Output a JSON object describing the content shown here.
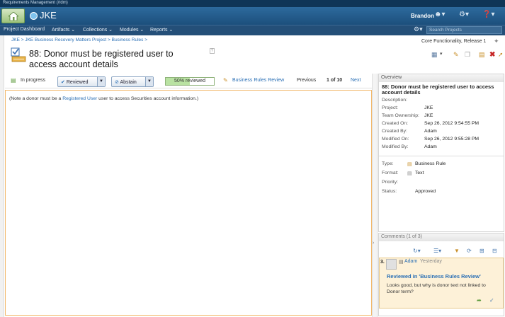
{
  "app": {
    "title": "Requirements Management (/rdm)",
    "project_name": "JKE"
  },
  "header": {
    "user": "Brandon"
  },
  "nav": {
    "items": [
      "Project Dashboard",
      "Artifacts ⌄",
      "Collections ⌄",
      "Modules ⌄",
      "Reports ⌄"
    ],
    "search_placeholder": "Search Projects"
  },
  "breadcrumb": "JKE > JKE Business Recovery Matters Project > Business Rules >",
  "artifact": {
    "title": "88:  Donor must be registered user to access account details"
  },
  "release": "Core Functionality, Release 1",
  "review": {
    "status": "In progress",
    "reviewed_label": "Reviewed",
    "abstain_label": "Abstain",
    "progress_text": "50% reviewed",
    "progress_fraction": 0.5,
    "review_name": "Business Rules Review",
    "previous": "Previous",
    "position": "1 of 10",
    "next": "Next"
  },
  "content": {
    "prefix": "(Note a donor must be a ",
    "link": "Registered User",
    "suffix": " user to access Securities account information.)"
  },
  "overview": {
    "heading": "Overview",
    "title": "88: Donor must be registered user to access account details",
    "rows": [
      {
        "label": "Description:",
        "value": ""
      },
      {
        "label": "Project:",
        "value": "JKE"
      },
      {
        "label": "Team Ownership:",
        "value": "JKE"
      },
      {
        "label": "Created On:",
        "value": "Sep 26, 2012 9:54:55 PM"
      },
      {
        "label": "Created By:",
        "value": "Adam"
      },
      {
        "label": "Modified On:",
        "value": "Sep 26, 2012 9:55:28 PM"
      },
      {
        "label": "Modified By:",
        "value": "Adam"
      }
    ],
    "attributes": [
      {
        "label": "Type:",
        "value": "Business Rule"
      },
      {
        "label": "Format:",
        "value": "Text"
      },
      {
        "label": "Priority:",
        "value": ""
      },
      {
        "label": "Status:",
        "value": "Approved"
      }
    ]
  },
  "comments": {
    "heading": "Comments (1 of 3)",
    "items": [
      {
        "number": "3.",
        "author": "Adam",
        "when": "Yesterday",
        "subject": "Reviewed in 'Business Rules Review'",
        "body": "Looks good, but why is donor text not linked to Donor term?"
      }
    ]
  },
  "colors": {
    "banner": "#1c4f7c",
    "navbar": "#244f78",
    "link": "#2a6fb5",
    "content_border": "#f2b86b",
    "comment_bg": "#fdf1d8"
  }
}
